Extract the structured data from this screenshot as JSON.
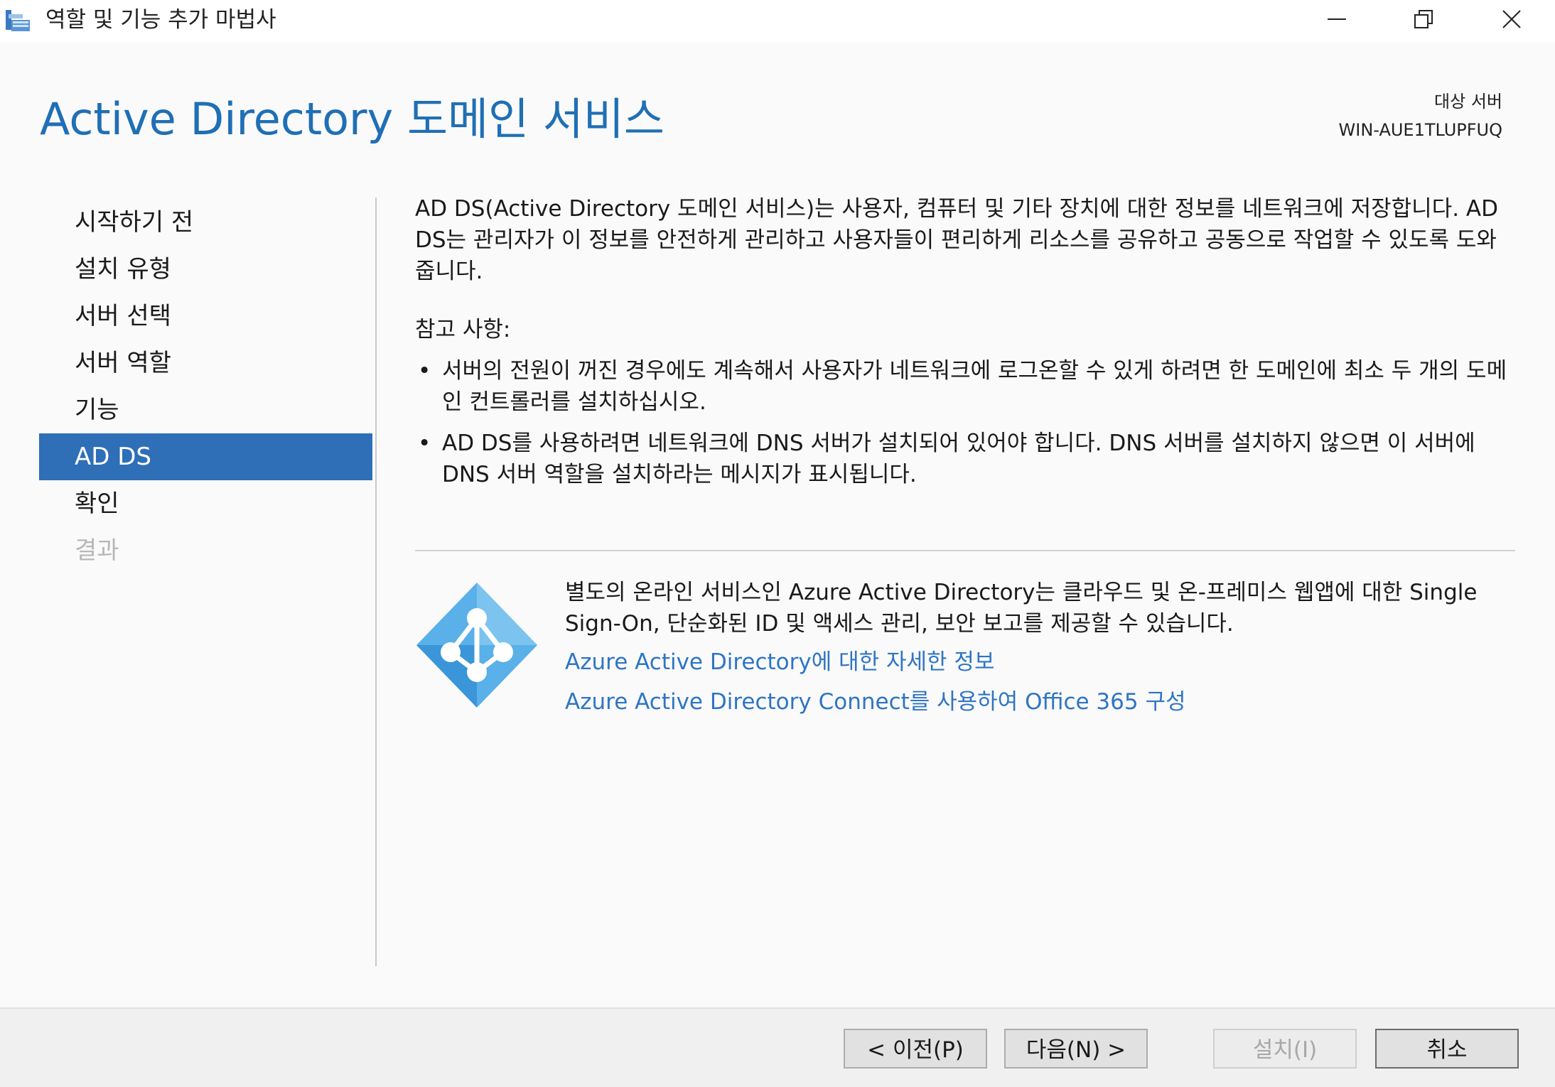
{
  "window": {
    "title": "역할 및 기능 추가 마법사",
    "app_icon": "server-manager-icon",
    "controls": {
      "minimize_icon": "minimize-icon",
      "restore_icon": "restore-icon",
      "close_icon": "close-icon"
    }
  },
  "header": {
    "title": "Active Directory 도메인 서비스",
    "target_label": "대상 서버",
    "target_server": "WIN-AUE1TLUPFUQ"
  },
  "nav": {
    "items": [
      {
        "label": "시작하기 전",
        "state": "normal"
      },
      {
        "label": "설치 유형",
        "state": "normal"
      },
      {
        "label": "서버 선택",
        "state": "normal"
      },
      {
        "label": "서버 역할",
        "state": "normal"
      },
      {
        "label": "기능",
        "state": "normal"
      },
      {
        "label": "AD DS",
        "state": "active"
      },
      {
        "label": "확인",
        "state": "normal"
      },
      {
        "label": "결과",
        "state": "disabled"
      }
    ]
  },
  "content": {
    "intro": "AD DS(Active Directory 도메인 서비스)는 사용자, 컴퓨터 및 기타 장치에 대한 정보를 네트워크에 저장합니다. AD DS는 관리자가 이 정보를 안전하게 관리하고 사용자들이 편리하게 리소스를 공유하고 공동으로 작업할 수 있도록 도와줍니다.",
    "notes_heading": "참고 사항:",
    "bullets": [
      "서버의 전원이 꺼진 경우에도 계속해서 사용자가 네트워크에 로그온할 수 있게 하려면 한 도메인에 최소 두 개의 도메인 컨트롤러를 설치하십시오.",
      "AD DS를 사용하려면 네트워크에 DNS 서버가 설치되어 있어야 합니다. DNS 서버를 설치하지 않으면 이 서버에 DNS 서버 역할을 설치하라는 메시지가 표시됩니다."
    ],
    "azure_icon": "azure-ad-icon",
    "azure_text": "별도의 온라인 서비스인 Azure Active Directory는 클라우드 및 온-프레미스 웹앱에 대한 Single Sign-On, 단순화된 ID 및 액세스 관리, 보안 보고를 제공할 수 있습니다.",
    "links": [
      "Azure Active Directory에 대한 자세한 정보",
      "Azure Active Directory Connect를 사용하여 Office 365 구성"
    ]
  },
  "footer": {
    "prev_label": "< 이전(P)",
    "next_label": "다음(N) >",
    "install_label": "설치(I)",
    "cancel_label": "취소"
  },
  "colors": {
    "accent": "#2e6fb7",
    "title_blue": "#1f6fb5",
    "link_blue": "#2e75c4",
    "azure_light": "#7cc4ef",
    "azure_dark": "#3a96d8"
  }
}
